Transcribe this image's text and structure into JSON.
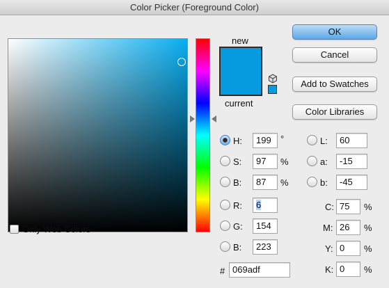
{
  "window": {
    "title": "Color Picker (Foreground Color)"
  },
  "colors": {
    "new": "#069adf",
    "current": "#069adf",
    "field_base": "#08adf0"
  },
  "preview": {
    "new_label": "new",
    "current_label": "current"
  },
  "buttons": {
    "ok": "OK",
    "cancel": "Cancel",
    "add_to_swatches": "Add to Swatches",
    "color_libraries": "Color Libraries"
  },
  "hsb": {
    "h": {
      "label": "H:",
      "value": "199",
      "unit": "°",
      "selected": true
    },
    "s": {
      "label": "S:",
      "value": "97",
      "unit": "%"
    },
    "b": {
      "label": "B:",
      "value": "87",
      "unit": "%"
    }
  },
  "rgb": {
    "r": {
      "label": "R:",
      "value": "6"
    },
    "g": {
      "label": "G:",
      "value": "154"
    },
    "b": {
      "label": "B:",
      "value": "223"
    }
  },
  "lab": {
    "l": {
      "label": "L:",
      "value": "60"
    },
    "a": {
      "label": "a:",
      "value": "-15"
    },
    "b": {
      "label": "b:",
      "value": "-45"
    }
  },
  "cmyk": {
    "c": {
      "label": "C:",
      "value": "75",
      "unit": "%"
    },
    "m": {
      "label": "M:",
      "value": "26",
      "unit": "%"
    },
    "y": {
      "label": "Y:",
      "value": "0",
      "unit": "%"
    },
    "k": {
      "label": "K:",
      "value": "0",
      "unit": "%"
    }
  },
  "hex": {
    "label": "#",
    "value": "069adf"
  },
  "only_web_colors": {
    "label": "Only Web Colors",
    "checked": false
  },
  "icons": {
    "gamut_cube": "cube-icon",
    "web_safe_swatch": "swatch-icon"
  }
}
